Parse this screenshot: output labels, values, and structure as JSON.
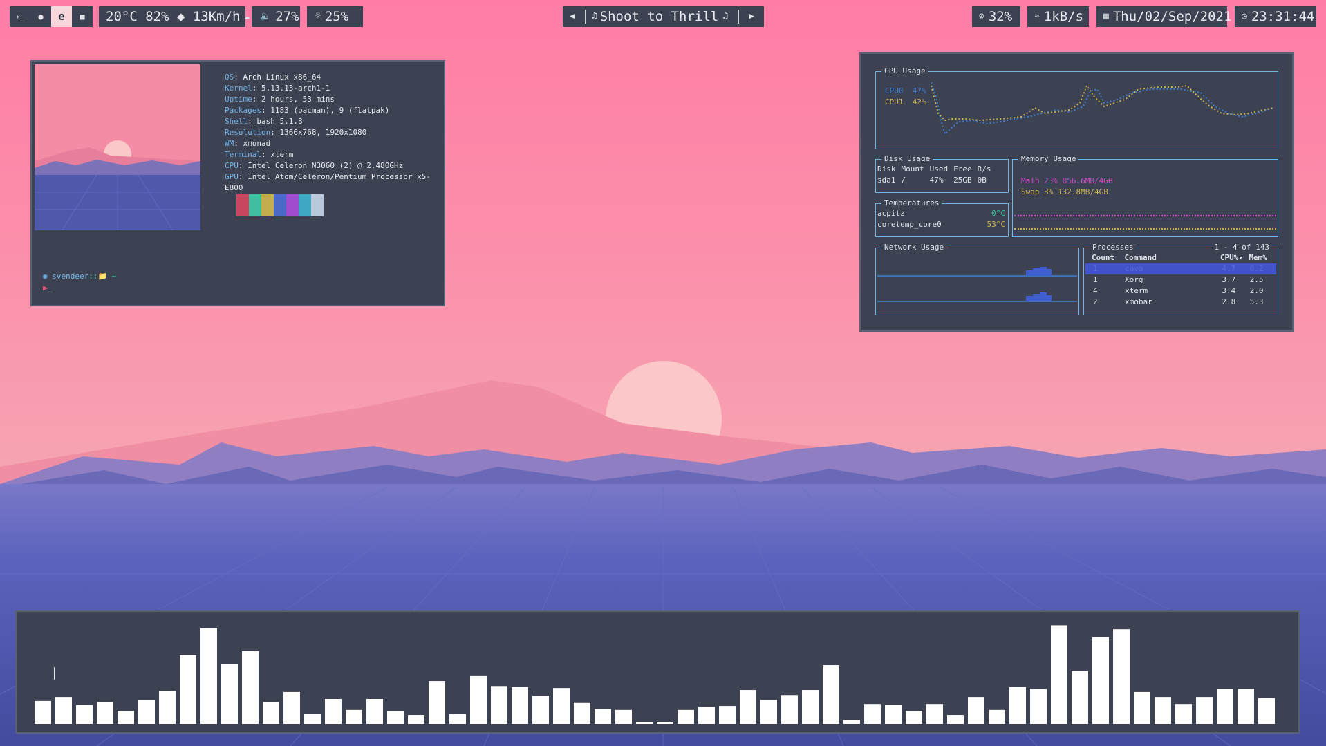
{
  "topbar": {
    "workspaces": [
      "›_",
      "●",
      "e",
      "■"
    ],
    "active_workspace": 2,
    "weather": "20°C 82% ◆ 13Km/h",
    "volume": "27%",
    "brightness": "25%",
    "media_title": "Shoot to Thrill",
    "disk": "32%",
    "network": "1kB/s",
    "date": "Thu/02/Sep/2021",
    "time": "23:31:44"
  },
  "neofetch": {
    "rows": [
      {
        "key": "OS",
        "val": ": Arch Linux x86_64"
      },
      {
        "key": "Kernel",
        "val": ": 5.13.13-arch1-1"
      },
      {
        "key": "Uptime",
        "val": ": 2 hours, 53 mins"
      },
      {
        "key": "Packages",
        "val": ": 1183 (pacman), 9 (flatpak)"
      },
      {
        "key": "Shell",
        "val": ": bash 5.1.8"
      },
      {
        "key": "Resolution",
        "val": ": 1366x768, 1920x1080"
      },
      {
        "key": "WM",
        "val": ": xmonad"
      },
      {
        "key": "Terminal",
        "val": ": xterm"
      },
      {
        "key": "CPU",
        "val": ": Intel Celeron N3060 (2) @ 2.480GHz"
      },
      {
        "key": "GPU",
        "val": ": Intel Atom/Celeron/Pentium Processor x5-E800"
      }
    ],
    "swatch_colors": [
      "#c8475e",
      "#3fbf9d",
      "#c3ad4e",
      "#4a6ac8",
      "#a04ccf",
      "#3fa6c3",
      "#b9c8da"
    ],
    "prompt_user": "svendeer",
    "prompt_path": "::📁 ~",
    "cursor": "_"
  },
  "monitor": {
    "cpu": {
      "title": "CPU Usage",
      "cores": [
        {
          "label": "CPU0",
          "value": "47%",
          "color": "#3f7fd1"
        },
        {
          "label": "CPU1",
          "value": "42%",
          "color": "#c8b24e"
        }
      ]
    },
    "disk": {
      "title": "Disk Usage",
      "headers": [
        "Disk",
        "Mount",
        "Used",
        "Free",
        "R/s"
      ],
      "rows": [
        [
          "sda1",
          "/",
          "47%",
          "25GB",
          "0B"
        ]
      ]
    },
    "memory": {
      "title": "Memory Usage",
      "main": "Main  23% 856.6MB/4GB",
      "swap": "Swap   3% 132.8MB/4GB",
      "main_color": "#d046c8",
      "swap_color": "#c8b24e"
    },
    "temps": {
      "title": "Temperatures",
      "rows": [
        {
          "name": "acpitz",
          "val": "0°C"
        },
        {
          "name": "coretemp_core0",
          "val": "53°C"
        }
      ]
    },
    "network": {
      "title": "Network Usage"
    },
    "processes": {
      "title": "Processes",
      "range": "1 - 4 of 143",
      "headers": [
        "Count",
        "Command",
        "CPU%▾",
        "Mem%"
      ],
      "rows": [
        [
          "1",
          "cava",
          "4.7",
          "0.2"
        ],
        [
          "1",
          "Xorg",
          "3.7",
          "2.5"
        ],
        [
          "4",
          "xterm",
          "3.4",
          "2.0"
        ],
        [
          "2",
          "xmobar",
          "2.8",
          "5.3"
        ]
      ]
    }
  },
  "visualizer": {
    "levels": [
      0.23,
      0.27,
      0.19,
      0.22,
      0.13,
      0.24,
      0.33,
      0.69,
      0.96,
      0.6,
      0.73,
      0.22,
      0.32,
      0.1,
      0.25,
      0.14,
      0.25,
      0.13,
      0.09,
      0.43,
      0.1,
      0.48,
      0.38,
      0.37,
      0.28,
      0.36,
      0.21,
      0.15,
      0.14,
      0.02,
      0.02,
      0.14,
      0.17,
      0.18,
      0.34,
      0.24,
      0.29,
      0.34,
      0.59,
      0.04,
      0.2,
      0.19,
      0.13,
      0.2,
      0.09,
      0.27,
      0.14,
      0.37,
      0.35,
      0.99,
      0.53,
      0.87,
      0.95,
      0.32,
      0.27,
      0.2,
      0.27,
      0.35,
      0.35,
      0.26
    ]
  },
  "colors": {
    "panel": "#3d4253",
    "accent": "#6fb4e7",
    "select": "#4252c8"
  }
}
